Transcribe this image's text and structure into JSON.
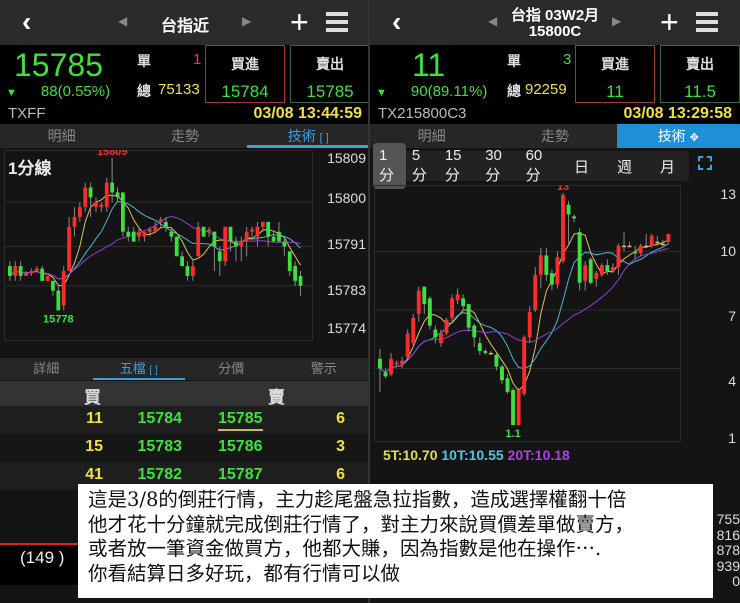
{
  "left": {
    "header": {
      "title": "台指近"
    },
    "quote": {
      "price": "15785",
      "change": "88(0.55%)",
      "single_label": "單",
      "single_value": "1",
      "total_label": "總",
      "total_value": "75133",
      "bid_label": "買進",
      "bid": "15784",
      "ask_label": "賣出",
      "ask": "15785"
    },
    "code": "TXFF",
    "datetime": "03/08 13:44:59",
    "tabs": [
      "明細",
      "走勢",
      "技術"
    ],
    "chart": {
      "period_label": "1分線",
      "high_label": "15809",
      "low_label": "15778",
      "y_ticks": [
        "15809",
        "15800",
        "15791",
        "15783",
        "15774"
      ]
    },
    "orderbook": {
      "tabs": [
        "詳細",
        "五檔",
        "分價",
        "警示"
      ],
      "buy_header": "買",
      "sell_header": "賣",
      "rows": [
        {
          "bid_qty": "11",
          "bid": "15784",
          "ask": "15785",
          "ask_qty": "6"
        },
        {
          "bid_qty": "15",
          "bid": "15783",
          "ask": "15786",
          "ask_qty": "3"
        },
        {
          "bid_qty": "41",
          "bid": "15782",
          "ask": "15787",
          "ask_qty": "6"
        }
      ]
    },
    "footer_count": "(149 )"
  },
  "right": {
    "header": {
      "title_line1": "台指 03W2月",
      "title_line2": "15800C"
    },
    "quote": {
      "price": "11",
      "change": "90(89.11%)",
      "single_label": "單",
      "single_value": "3",
      "total_label": "總",
      "total_value": "92259",
      "bid_label": "買進",
      "bid": "11",
      "ask_label": "賣出",
      "ask": "11.5"
    },
    "code": "TX215800C3",
    "datetime": "03/08 13:29:58",
    "tabs": [
      "明細",
      "走勢",
      "技術"
    ],
    "periods": [
      "1分",
      "5分",
      "15分",
      "30分",
      "60分",
      "日",
      "週",
      "月"
    ],
    "chart": {
      "high_label": "13",
      "low_label": "1.1",
      "y_ticks": [
        "13",
        "10",
        "7",
        "4",
        "1"
      ],
      "ma5": "5T:10.70",
      "ma10": "10T:10.55",
      "ma20": "20T:10.18"
    },
    "side_values": [
      "755",
      "816",
      "878",
      "939",
      "0"
    ]
  },
  "note": {
    "lines": [
      "這是3/8的倒莊行情，主力趁尾盤急拉指數，造成選擇權翻十倍",
      "他才花十分鐘就完成倒莊行情了，對主力來說買價差單做賣方，",
      "或者放一筆資金做買方，他都大賺，因為指數是他在操作⋯.",
      "你看結算日多好玩，都有行情可以做"
    ]
  },
  "colors": {
    "up": "#ff2a2a",
    "down": "#3de03d",
    "ma5": "#e0c060",
    "ma10": "#4ab8c8",
    "ma20": "#9040d0",
    "accent": "#3ba0e0"
  },
  "chart_data": [
    {
      "type": "candlestick",
      "title": "1分線",
      "ylim": [
        15774,
        15809
      ],
      "ohlc": [
        [
          15787,
          15785,
          15788,
          15784
        ],
        [
          15785,
          15787,
          15788,
          15784
        ],
        [
          15787,
          15785,
          15788,
          15784
        ],
        [
          15785,
          15785.5,
          15786,
          15785
        ],
        [
          15785.5,
          15786,
          15786.5,
          15785
        ],
        [
          15786,
          15786.5,
          15787,
          15786
        ],
        [
          15786.5,
          15784,
          15787,
          15784
        ],
        [
          15784,
          15785,
          15785,
          15784
        ],
        [
          15784,
          15782,
          15784,
          15781
        ],
        [
          15782,
          15778,
          15783,
          15778
        ],
        [
          15779,
          15786,
          15787,
          15778
        ],
        [
          15786,
          15795,
          15797,
          15786
        ],
        [
          15795,
          15797,
          15799,
          15793
        ],
        [
          15797,
          15799,
          15800,
          15796
        ],
        [
          15799,
          15803,
          15804,
          15798
        ],
        [
          15803,
          15801,
          15804,
          15797
        ],
        [
          15799,
          15800,
          15801,
          15798
        ],
        [
          15799,
          15799.5,
          15800,
          15798
        ],
        [
          15799,
          15804,
          15805,
          15798
        ],
        [
          15804,
          15802,
          15809,
          15800
        ],
        [
          15802,
          15801,
          15803,
          15800
        ],
        [
          15802,
          15794,
          15802,
          15793
        ],
        [
          15794,
          15793,
          15795,
          15792
        ],
        [
          15794,
          15792,
          15795,
          15792
        ],
        [
          15793,
          15794,
          15795,
          15792
        ],
        [
          15793,
          15794,
          15794,
          15792
        ],
        [
          15794,
          15794.5,
          15795,
          15793
        ],
        [
          15794,
          15795,
          15796,
          15794
        ],
        [
          15796,
          15796.5,
          15797,
          15795
        ],
        [
          15796,
          15795,
          15797,
          15794
        ],
        [
          15794,
          15793,
          15795,
          15792
        ],
        [
          15793,
          15789,
          15793,
          15789
        ],
        [
          15789,
          15787,
          15790,
          15787
        ],
        [
          15787,
          15785,
          15788,
          15784
        ],
        [
          15785,
          15787,
          15788,
          15784
        ],
        [
          15789,
          15795,
          15796,
          15789
        ],
        [
          15795,
          15793,
          15795,
          15793
        ],
        [
          15794,
          15794.5,
          15795,
          15793
        ],
        [
          15794,
          15791,
          15794,
          15786
        ],
        [
          15790,
          15788,
          15791,
          15785
        ],
        [
          15788,
          15795,
          15795,
          15787
        ],
        [
          15795,
          15792,
          15795,
          15790
        ],
        [
          15792,
          15791,
          15793,
          15788
        ],
        [
          15791,
          15792,
          15793,
          15788
        ],
        [
          15792,
          15794,
          15795,
          15789
        ],
        [
          15794,
          15794.5,
          15795,
          15793
        ],
        [
          15793,
          15795,
          15796,
          15791
        ],
        [
          15795,
          15796,
          15796,
          15794
        ],
        [
          15796,
          15793,
          15796,
          15791
        ],
        [
          15793,
          15792,
          15794,
          15792
        ],
        [
          15794,
          15792,
          15796,
          15792
        ],
        [
          15792,
          15791,
          15793,
          15789
        ],
        [
          15790,
          15786,
          15790,
          15785
        ],
        [
          15787,
          15784,
          15788,
          15783
        ],
        [
          15785,
          15783,
          15786,
          15781
        ]
      ]
    },
    {
      "type": "candlestick",
      "title": "1分",
      "ylim": [
        1,
        13
      ],
      "ohlc": [
        [
          4.5,
          4,
          5,
          2.8
        ],
        [
          3.8,
          3.6,
          4,
          3.5
        ],
        [
          3.7,
          4.5,
          4.8,
          3.6
        ],
        [
          4.2,
          4.3,
          4.4,
          4.1
        ],
        [
          4.2,
          4.4,
          4.6,
          4
        ],
        [
          4.6,
          5.8,
          6,
          4.4
        ],
        [
          5.3,
          6.6,
          6.8,
          5.1
        ],
        [
          6.8,
          8,
          8.2,
          6.4
        ],
        [
          8.2,
          7.3,
          8.2,
          6.8
        ],
        [
          7.6,
          6.2,
          7.7,
          6
        ],
        [
          6,
          5.6,
          6.2,
          5.3
        ],
        [
          5.3,
          5.8,
          6,
          5.1
        ],
        [
          5.8,
          6.5,
          6.6,
          5.7
        ],
        [
          6.6,
          7.6,
          7.8,
          6.3
        ],
        [
          7.5,
          7.8,
          8.1,
          7.3
        ],
        [
          7.6,
          7.2,
          7.8,
          7
        ],
        [
          7.3,
          6.1,
          7.3,
          5.9
        ],
        [
          6.2,
          5.6,
          6.3,
          5.1
        ],
        [
          5.3,
          4.9,
          5.6,
          4.7
        ],
        [
          4.9,
          4.8,
          5,
          4.7
        ],
        [
          4.8,
          4.8,
          4.9,
          4.7
        ],
        [
          4.7,
          4.1,
          4.8,
          3.9
        ],
        [
          4.1,
          3.4,
          4.2,
          3.2
        ],
        [
          3.5,
          2.8,
          3.7,
          2.7
        ],
        [
          2.9,
          1.1,
          3,
          1.1
        ],
        [
          1.1,
          2.9,
          3,
          1.1
        ],
        [
          2.7,
          5.6,
          5.7,
          2.6
        ],
        [
          5.6,
          6.9,
          7.2,
          5.3
        ],
        [
          7,
          8.8,
          9.2,
          6.9
        ],
        [
          8.8,
          9.8,
          10.2,
          8.1
        ],
        [
          9.8,
          8.8,
          10.2,
          8.5
        ],
        [
          8.9,
          8.3,
          9.1,
          8
        ],
        [
          8.3,
          9.7,
          10,
          8.1
        ],
        [
          9.5,
          12.9,
          13,
          9.4
        ],
        [
          12.4,
          11.9,
          12.6,
          10.4
        ],
        [
          11.8,
          11.7,
          11.9,
          11.5
        ],
        [
          11,
          8.4,
          11.2,
          8
        ],
        [
          8.5,
          9.3,
          9.5,
          8
        ],
        [
          9.6,
          8.4,
          9.7,
          8.3
        ],
        [
          8.6,
          8.9,
          9,
          8.2
        ],
        [
          8.8,
          9.3,
          9.4,
          8.7
        ],
        [
          9.3,
          9,
          9.6,
          8.8
        ],
        [
          9,
          9.2,
          9.4,
          8.9
        ],
        [
          9.2,
          10.3,
          10.4,
          8.8
        ],
        [
          10.3,
          10.3,
          11,
          10
        ],
        [
          10.3,
          10.3,
          10.5,
          10.2
        ],
        [
          10,
          9.9,
          10.3,
          9.6
        ],
        [
          9.9,
          10.3,
          10.4,
          9.8
        ],
        [
          10.3,
          10.3,
          10.9,
          10.2
        ],
        [
          10.3,
          10.8,
          10.9,
          10.2
        ],
        [
          10.5,
          10.5,
          10.8,
          10.3
        ],
        [
          10.4,
          10.4,
          10.6,
          10.3
        ],
        [
          10.5,
          10.9,
          10.9,
          10.4
        ]
      ]
    }
  ]
}
